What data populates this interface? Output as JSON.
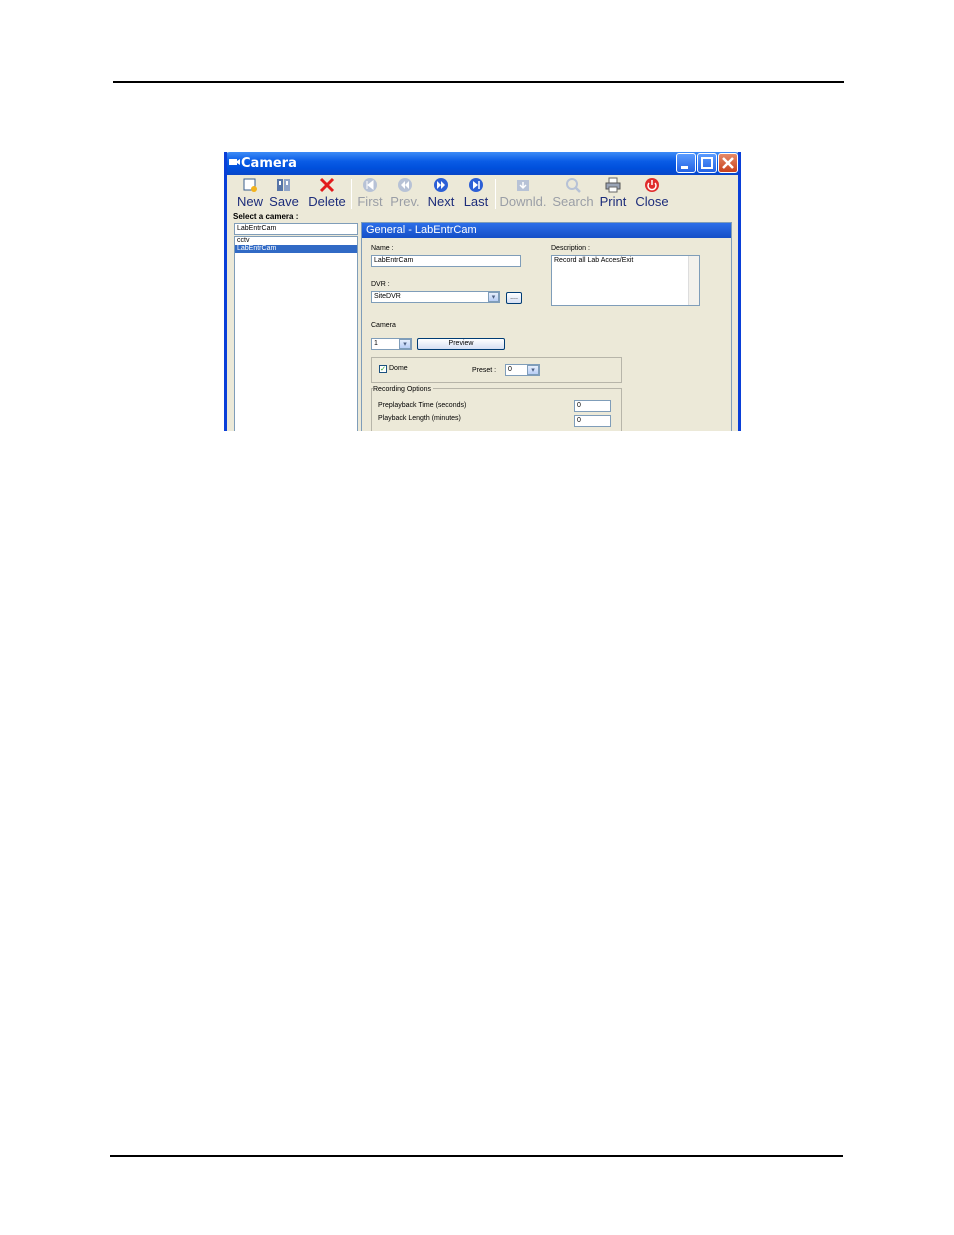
{
  "window": {
    "title": "Camera"
  },
  "toolbar": {
    "new": "New",
    "save": "Save",
    "delete": "Delete",
    "first": "First",
    "prev": "Prev.",
    "next": "Next",
    "last": "Last",
    "download": "Downld.",
    "search": "Search",
    "print": "Print",
    "close": "Close"
  },
  "sidebar": {
    "label": "Select a camera :",
    "search_value": "LabEntrCam",
    "items": [
      "cctv",
      "LabEntrCam"
    ],
    "selected": "LabEntrCam"
  },
  "panel": {
    "title": "General - LabEntrCam",
    "name_label": "Name :",
    "name_value": "LabEntrCam",
    "description_label": "Description :",
    "description_value": "Record all Lab Acces/Exit",
    "dvr_label": "DVR :",
    "dvr_value": "SiteDVR",
    "browse_label": "....",
    "camera_label": "Camera",
    "camera_value": "1",
    "preview_label": "Preview",
    "dome_label": "Dome",
    "dome_checked": true,
    "preset_label": "Preset :",
    "preset_value": "0",
    "recording_legend": "Recording Options",
    "preplayback_label": "Preplayback Time (seconds)",
    "preplayback_value": "0",
    "playback_label": "Playback Length (minutes)",
    "playback_value": "0"
  },
  "colors": {
    "titlebar": "#0a5ce6",
    "selection": "#316ac5",
    "panel_header": "#2c6ee8"
  }
}
